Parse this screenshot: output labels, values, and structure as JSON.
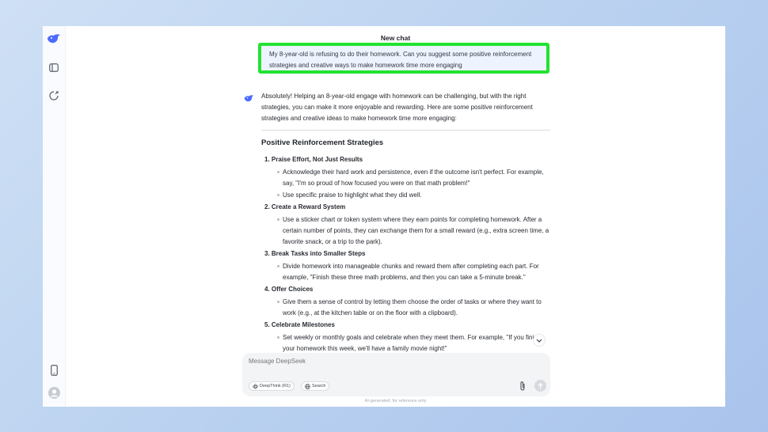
{
  "header": {
    "title": "New chat"
  },
  "user_message": "My 8-year-old is refusing to do their homework. Can you suggest some positive reinforcement strategies and creative ways to make homework time more engaging",
  "assistant": {
    "intro": "Absolutely! Helping an 8-year-old engage with homework can be challenging, but with the right strategies, you can make it more enjoyable and rewarding. Here are some positive reinforcement strategies and creative ideas to make homework time more engaging:",
    "section_heading": "Positive Reinforcement Strategies",
    "items": [
      {
        "title": "1. Praise Effort, Not Just Results",
        "bullets": [
          "Acknowledge their hard work and persistence, even if the outcome isn't perfect. For example, say, \"I'm so proud of how focused you were on that math problem!\"",
          "Use specific praise to highlight what they did well."
        ]
      },
      {
        "title": "2. Create a Reward System",
        "bullets": [
          "Use a sticker chart or token system where they earn points for completing homework. After a certain number of points, they can exchange them for a small reward (e.g., extra screen time, a favorite snack, or a trip to the park)."
        ]
      },
      {
        "title": "3. Break Tasks into Smaller Steps",
        "bullets": [
          "Divide homework into manageable chunks and reward them after completing each part. For example, \"Finish these three math problems, and then you can take a 5-minute break.\""
        ]
      },
      {
        "title": "4. Offer Choices",
        "bullets": [
          "Give them a sense of control by letting them choose the order of tasks or where they want to work (e.g., at the kitchen table or on the floor with a clipboard)."
        ]
      },
      {
        "title": "5. Celebrate Milestones",
        "bullets": [
          "Set weekly or monthly goals and celebrate when they meet them. For example, \"If you finish your homework this week, we'll have a family movie night!\""
        ]
      }
    ]
  },
  "composer": {
    "placeholder": "Message DeepSeek",
    "deepthink_label": "DeepThink (R1)",
    "search_label": "Search"
  },
  "footer": {
    "disclaimer": "AI-generated, for reference only"
  },
  "colors": {
    "brand": "#4d6bfe",
    "highlight_border": "#22e232",
    "user_bubble": "#eef4ff"
  },
  "icons": {
    "logo": "deepseek-whale-icon",
    "sidebar_toggle": "sidebar-toggle-icon",
    "new_chat": "new-chat-icon",
    "mobile": "mobile-app-icon",
    "profile": "user-avatar-icon",
    "attach": "paperclip-icon",
    "send": "send-arrow-icon",
    "scroll": "chevron-down-icon"
  }
}
